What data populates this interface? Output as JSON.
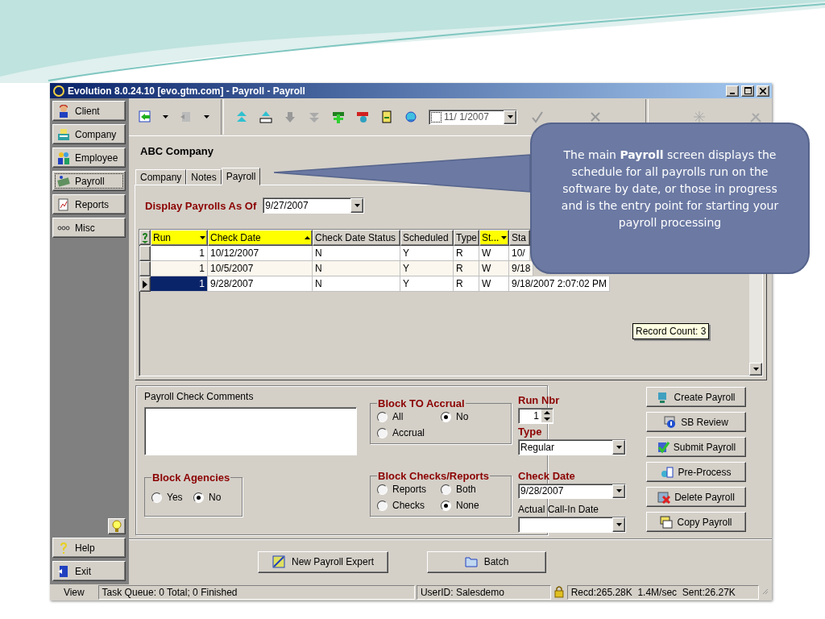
{
  "window": {
    "title": "Evolution 8.0.24.10 [evo.gtm.com] - Payroll - Payroll"
  },
  "sidebar": {
    "items": [
      {
        "label": "Client",
        "selected": false
      },
      {
        "label": "Company",
        "selected": false
      },
      {
        "label": "Employee",
        "selected": false
      },
      {
        "label": "Payroll",
        "selected": true
      },
      {
        "label": "Reports",
        "selected": false
      },
      {
        "label": "Misc",
        "selected": false
      }
    ],
    "bottom_items": [
      "Help",
      "Exit"
    ]
  },
  "toolbar": {
    "date_field": {
      "value": "11/ 1/2007",
      "checked": false
    }
  },
  "company_name": "ABC Company",
  "tabs": [
    {
      "label": "Company",
      "selected": false
    },
    {
      "label": "Notes",
      "selected": false
    },
    {
      "label": "Payroll",
      "selected": true
    }
  ],
  "display_as_of": {
    "label": "Display Payrolls As Of",
    "value": "9/27/2007"
  },
  "table": {
    "columns": [
      {
        "label": "Run",
        "highlighted": true,
        "sorted": true,
        "ascending": false
      },
      {
        "label": "Check Date",
        "highlighted": true,
        "sorted": true,
        "ascending": true
      },
      {
        "label": "Check Date Status",
        "highlighted": false,
        "sorted": false
      },
      {
        "label": "Scheduled",
        "highlighted": false,
        "sorted": false
      },
      {
        "label": "Type",
        "highlighted": false,
        "sorted": false
      },
      {
        "label": "St...",
        "highlighted": true,
        "sorted": true,
        "ascending": false
      },
      {
        "label": "Sta",
        "highlighted": false,
        "sorted": false
      }
    ],
    "rows": [
      {
        "selected": false,
        "cells": [
          "1",
          "10/12/2007",
          "N",
          "Y",
          "R",
          "W",
          "10/"
        ]
      },
      {
        "selected": false,
        "cells": [
          "1",
          "10/5/2007",
          "N",
          "Y",
          "R",
          "W",
          "9/18"
        ]
      },
      {
        "selected": true,
        "cells": [
          "1",
          "9/28/2007",
          "N",
          "Y",
          "R",
          "W",
          "9/18/2007 2:07:02 PM"
        ]
      }
    ]
  },
  "record_count": "Record Count: 3",
  "comments": {
    "label": "Payroll Check Comments"
  },
  "block_to_accrual": {
    "title": "Block TO Accrual",
    "options": [
      {
        "label": "All",
        "selected": false
      },
      {
        "label": "No",
        "selected": true
      },
      {
        "label": "Accrual",
        "selected": false
      }
    ]
  },
  "block_agencies": {
    "title": "Block Agencies",
    "options": [
      {
        "label": "Yes",
        "selected": false
      },
      {
        "label": "No",
        "selected": true
      }
    ]
  },
  "block_checks_reports": {
    "title": "Block Checks/Reports",
    "options": [
      {
        "label": "Reports",
        "selected": false
      },
      {
        "label": "Both",
        "selected": false
      },
      {
        "label": "Checks",
        "selected": false
      },
      {
        "label": "None",
        "selected": true
      }
    ]
  },
  "run_nbr": {
    "label": "Run Nbr",
    "value": "1"
  },
  "type": {
    "label": "Type",
    "value": "Regular"
  },
  "check_date": {
    "label": "Check Date",
    "value": "9/28/2007"
  },
  "actual_call_in_date": {
    "label": "Actual Call-In Date"
  },
  "actions": [
    "Create Payroll",
    "SB Review",
    "Submit Payroll",
    "Pre-Process",
    "Delete Payroll",
    "Copy Payroll"
  ],
  "bottom_buttons": [
    "New Payroll Expert",
    "Batch"
  ],
  "status_bar": {
    "view": "View",
    "task_queue": "Task Queue: 0 Total; 0 Finished",
    "user": "UserID: Salesdemo",
    "traffic": "Recd:265.28K  1.4M/sec  Sent:26.27K"
  },
  "callout": {
    "text": "The main **Payroll** screen displays the schedule for all payrolls run on the software by date, or those in progress and is the entry point for starting your payroll processing"
  }
}
